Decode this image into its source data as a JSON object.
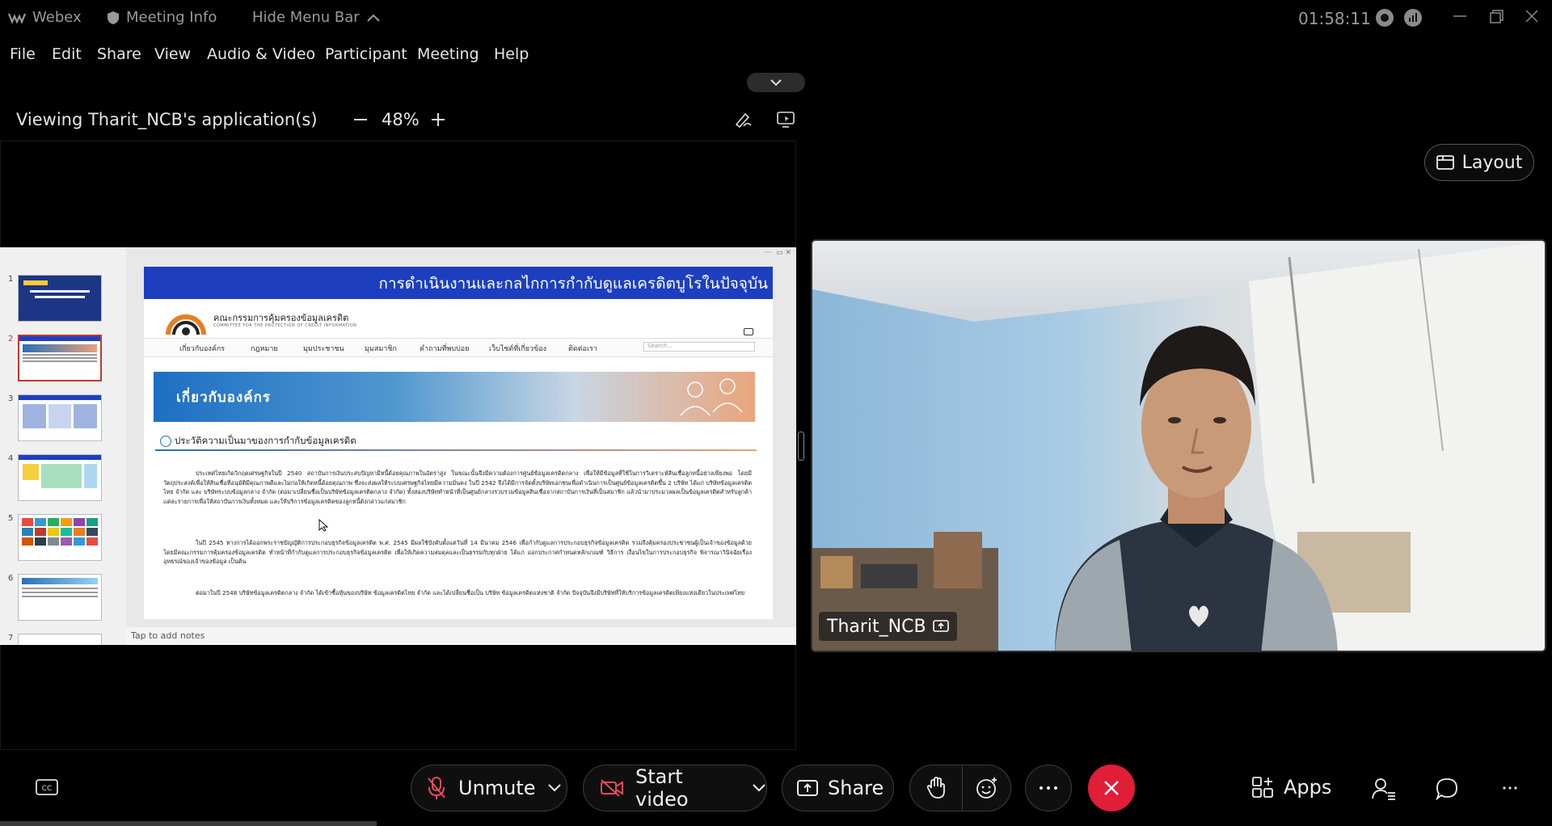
{
  "titlebar": {
    "app_name": "Webex",
    "meeting_info": "Meeting Info",
    "hide_menu": "Hide Menu Bar",
    "clock": "01:58:11"
  },
  "menu": [
    "File",
    "Edit",
    "Share",
    "View",
    "Audio & Video",
    "Participant",
    "Meeting",
    "Help"
  ],
  "viewing": {
    "label": "Viewing Tharit_NCB's application(s)",
    "zoom": "48%"
  },
  "slide": {
    "header": "การดำเนินงานและกลไกการกำกับดูแลเครดิตบูโรในปัจจุบัน",
    "org_name": "คณะกรรมการคุ้มครองข้อมูลเครดิต",
    "org_sub": "COMMITTEE FOR THE PROTECTION OF CREDIT INFORMATION",
    "nav": [
      "เกี่ยวกับองค์กร",
      "กฎหมาย",
      "มุมประชาชน",
      "มุมสมาชิก",
      "คำถามที่พบบ่อย",
      "เว็บไซต์ที่เกี่ยวข้อง",
      "ติดต่อเรา"
    ],
    "search_placeholder": "Search...",
    "banner": "เกี่ยวกับองค์กร",
    "section_title": "ประวัติความเป็นมาของการกำกับข้อมูลเครดิต",
    "para1": "ประเทศไทยเกิดวิกฤตเศรษฐกิจในปี 2540 สถาบันการเงินประสบปัญหามีหนี้ด้อยคุณภาพในอัตราสูง ในขณะนั้นจึงมีความต้องการศูนย์ข้อมูลเครดิตกลาง เพื่อให้มีข้อมูลที่ใช้ในการวิเคราะห์สินเชื่อลูกหนี้อย่างเพียงพอ โดยมีวัตถุประสงค์เพื่อให้สินเชื่อที่อนุมัติมีคุณภาพดีและไม่ก่อให้เกิดหนี้ด้อยคุณภาพ ซึ่งจะส่งผลให้ระบบเศรษฐกิจไทยมีความมั่นคง ในปี 2542 จึงได้มีการจัดตั้งบริษัทเอกชนเพื่อดำเนินการเป็นศูนย์ข้อมูลเครดิตขึ้น 2 บริษัท ได้แก่ บริษัทข้อมูลเครดิตไทย จำกัด และ บริษัทระบบข้อมูลกลาง จำกัด (ต่อมาเปลี่ยนชื่อเป็นบริษัทข้อมูลเครดิตกลาง จำกัด) ทั้งสองบริษัททำหน้าที่เป็นศูนย์กลางรวบรวมข้อมูลสินเชื่อจากสถาบันการเงินที่เป็นสมาชิก แล้วนำมาประมวลผลเป็นข้อมูลเครดิตสำหรับลูกค้าแต่ละรายการเพื่อให้สถาบันการเงินทั้งหมด และให้บริการข้อมูลเครดิตของลูกหนี้ดังกล่าวแก่สมาชิก",
    "para2": "ในปี 2545 ทางการได้ออกพระราชบัญญัติการประกอบธุรกิจข้อมูลเครดิต พ.ศ. 2545 มีผลใช้บังคับตั้งแต่วันที่ 14 มีนาคม 2546 เพื่อกำกับดูแลการประกอบธุรกิจข้อมูลเครดิต รวมถึงคุ้มครองประชาชนผู้เป็นเจ้าของข้อมูลด้วย โดยมีคณะกรรมการคุ้มครองข้อมูลเครดิต ทำหน้าที่กำกับดูแลการประกอบธุรกิจข้อมูลเครดิต เพื่อให้เกิดความสมดุลและเป็นธรรมกับทุกฝ่าย ได้แก่ ออกประกาศกำหนดหลักเกณฑ์ วิธีการ เงื่อนไขในการประกอบธุรกิจ พิจารณาวินิจฉัยเรื่องอุทธรณ์ของเจ้าของข้อมูล เป็นต้น",
    "para3": "ต่อมาในปี 2548 บริษัทข้อมูลเครดิตกลาง จำกัด ได้เข้าซื้อหุ้นของบริษัท ข้อมูลเครดิตไทย จำกัด และได้เปลี่ยนชื่อเป็น บริษัท ข้อมูลเครดิตแห่งชาติ จำกัด ปัจจุบันจึงมีบริษัทที่ให้บริการข้อมูลเครดิตเพียงแห่งเดียวในประเทศไทย",
    "notes": "Tap to add notes",
    "thumb_numbers": [
      "1",
      "2",
      "3",
      "4",
      "5",
      "6",
      "7"
    ]
  },
  "video": {
    "participant": "Tharit_NCB"
  },
  "layout_label": "Layout",
  "controls": {
    "unmute": "Unmute",
    "start_video": "Start video",
    "share": "Share",
    "apps": "Apps"
  },
  "colors": {
    "end_call": "#e01e37",
    "slide_header": "#1d3fbf"
  }
}
